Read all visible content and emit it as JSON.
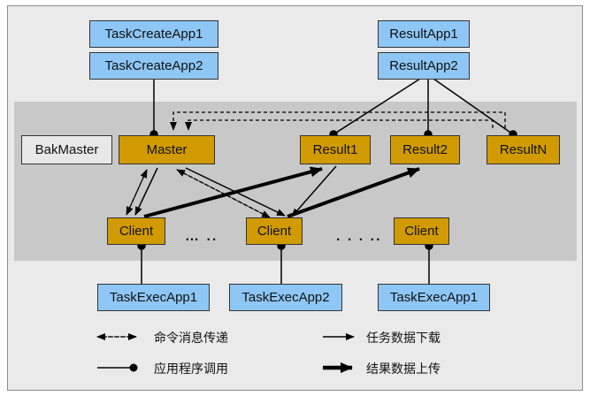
{
  "apps": {
    "task_create_1": "TaskCreateApp1",
    "task_create_2": "TaskCreateApp2",
    "result_app_1": "ResultApp1",
    "result_app_2": "ResultApp2",
    "task_exec_1": "TaskExecApp1",
    "task_exec_2": "TaskExecApp2",
    "task_exec_3": "TaskExecApp1"
  },
  "nodes": {
    "bak_master": "BakMaster",
    "master": "Master",
    "result1": "Result1",
    "result2": "Result2",
    "resultN": "ResultN",
    "client1": "Client",
    "client2": "Client",
    "client3": "Client"
  },
  "ellipsis": {
    "first": "… ..",
    "second": ". . . .."
  },
  "legend": {
    "command": "命令消息传递",
    "app_call": "应用程序调用",
    "task_download": "任务数据下载",
    "result_upload": "结果数据上传"
  },
  "colors": {
    "app_fill": "#8ec7f6",
    "core_fill": "#d19b00",
    "band_fill": "#c8c8c8",
    "background": "#eaeaea"
  }
}
